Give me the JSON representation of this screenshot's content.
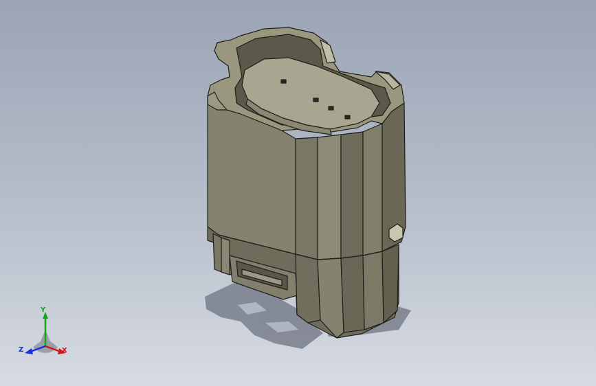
{
  "viewport": {
    "background_top": "#9aa4b4",
    "background_bottom": "#d7dbe2"
  },
  "model": {
    "name": "connector-housing",
    "body_color": "#7d7a68",
    "shade_color": "#5f5c4d",
    "highlight_color": "#b3b09c",
    "edge_color": "#1e1e1a",
    "shadow_color": "#6e7480"
  },
  "triad": {
    "x_label": "X",
    "y_label": "Y",
    "z_label": "Z",
    "x_color": "#d01818",
    "y_color": "#10a818",
    "z_color": "#1830d8"
  }
}
